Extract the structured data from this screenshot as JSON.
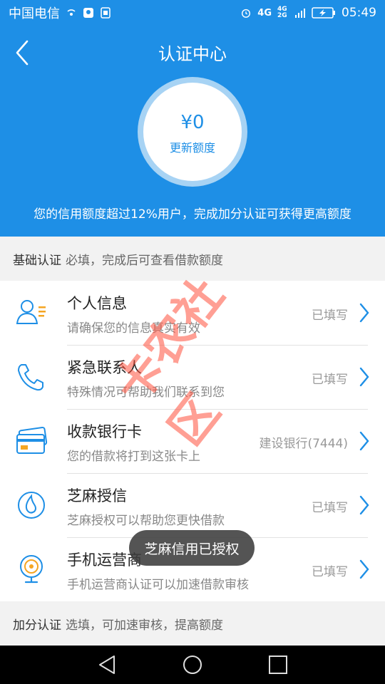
{
  "status_bar": {
    "carrier": "中国电信",
    "network": "4G",
    "network2": "4G 2G",
    "time": "05:49"
  },
  "header": {
    "title": "认证中心",
    "amount": "¥0",
    "amount_label": "更新额度",
    "hint": "您的信用额度超过12%用户，完成加分认证可获得更高额度"
  },
  "basic_section": {
    "label": "基础认证",
    "desc": "必填，完成后可查看借款额度"
  },
  "items": [
    {
      "title": "个人信息",
      "subtitle": "请确保您的信息真实有效",
      "status": "已填写",
      "icon": "person-icon"
    },
    {
      "title": "紧急联系人",
      "subtitle": "特殊情况可帮助我们联系到您",
      "status": "已填写",
      "icon": "phone-icon"
    },
    {
      "title": "收款银行卡",
      "subtitle": "您的借款将打到这张卡上",
      "status": "建设银行(7444)",
      "icon": "bank-card-icon"
    },
    {
      "title": "芝麻授信",
      "subtitle": "芝麻授权可以帮助您更快借款",
      "status": "已填写",
      "icon": "sesame-icon"
    },
    {
      "title": "手机运营商",
      "subtitle": "手机运营商认证可以加速借款审核",
      "status": "已填写",
      "icon": "operator-icon"
    }
  ],
  "extra_section": {
    "label": "加分认证",
    "desc": "选填，可加速审核，提高额度"
  },
  "toast": "芝麻信用已授权",
  "watermark": "卡农社区",
  "colors": {
    "primary": "#1e8fe6",
    "background": "#f2f2f2",
    "watermark": "#ff503c"
  }
}
